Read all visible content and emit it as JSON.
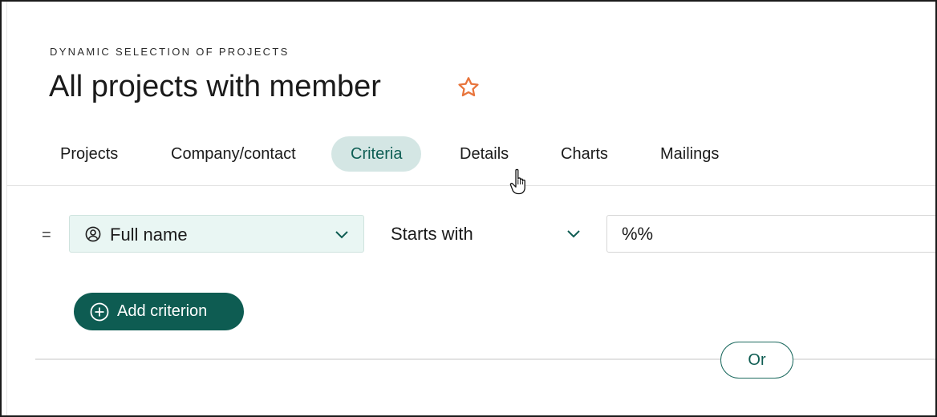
{
  "header": {
    "subtitle": "DYNAMIC SELECTION OF PROJECTS",
    "title": "All projects with member",
    "favorite_icon": "star-outline-icon"
  },
  "tabs": [
    {
      "label": "Projects",
      "active": false
    },
    {
      "label": "Company/contact",
      "active": false
    },
    {
      "label": "Criteria",
      "active": true
    },
    {
      "label": "Details",
      "active": false
    },
    {
      "label": "Charts",
      "active": false
    },
    {
      "label": "Mailings",
      "active": false
    }
  ],
  "criterion": {
    "operator_prefix": "=",
    "field": {
      "label": "Full name",
      "icon": "person-circle-icon"
    },
    "condition": {
      "label": "Starts with"
    },
    "value": "%%"
  },
  "actions": {
    "add_criterion_label": "Add criterion",
    "or_label": "Or"
  },
  "colors": {
    "accent": "#0e5c52",
    "active_tab_bg": "#d4e6e4",
    "field_bg": "#e9f6f3",
    "star": "#e8743b"
  }
}
